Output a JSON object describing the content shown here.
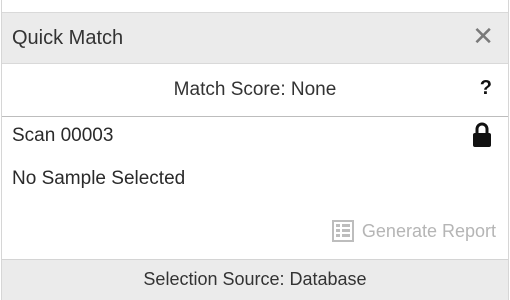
{
  "window": {
    "title": "Quick Match",
    "close_icon": "close-icon",
    "close_glyph": "✕"
  },
  "match": {
    "score_text": "Match Score: None",
    "help_label": "?"
  },
  "scan": {
    "name": "Scan 00003",
    "lock_icon": "lock-icon"
  },
  "sample": {
    "status": "No Sample Selected"
  },
  "actions": {
    "generate_report_label": "Generate Report",
    "generate_report_icon": "report-icon",
    "disabled_color": "#b5b5b5"
  },
  "footer": {
    "selection_source": "Selection Source: Database"
  }
}
